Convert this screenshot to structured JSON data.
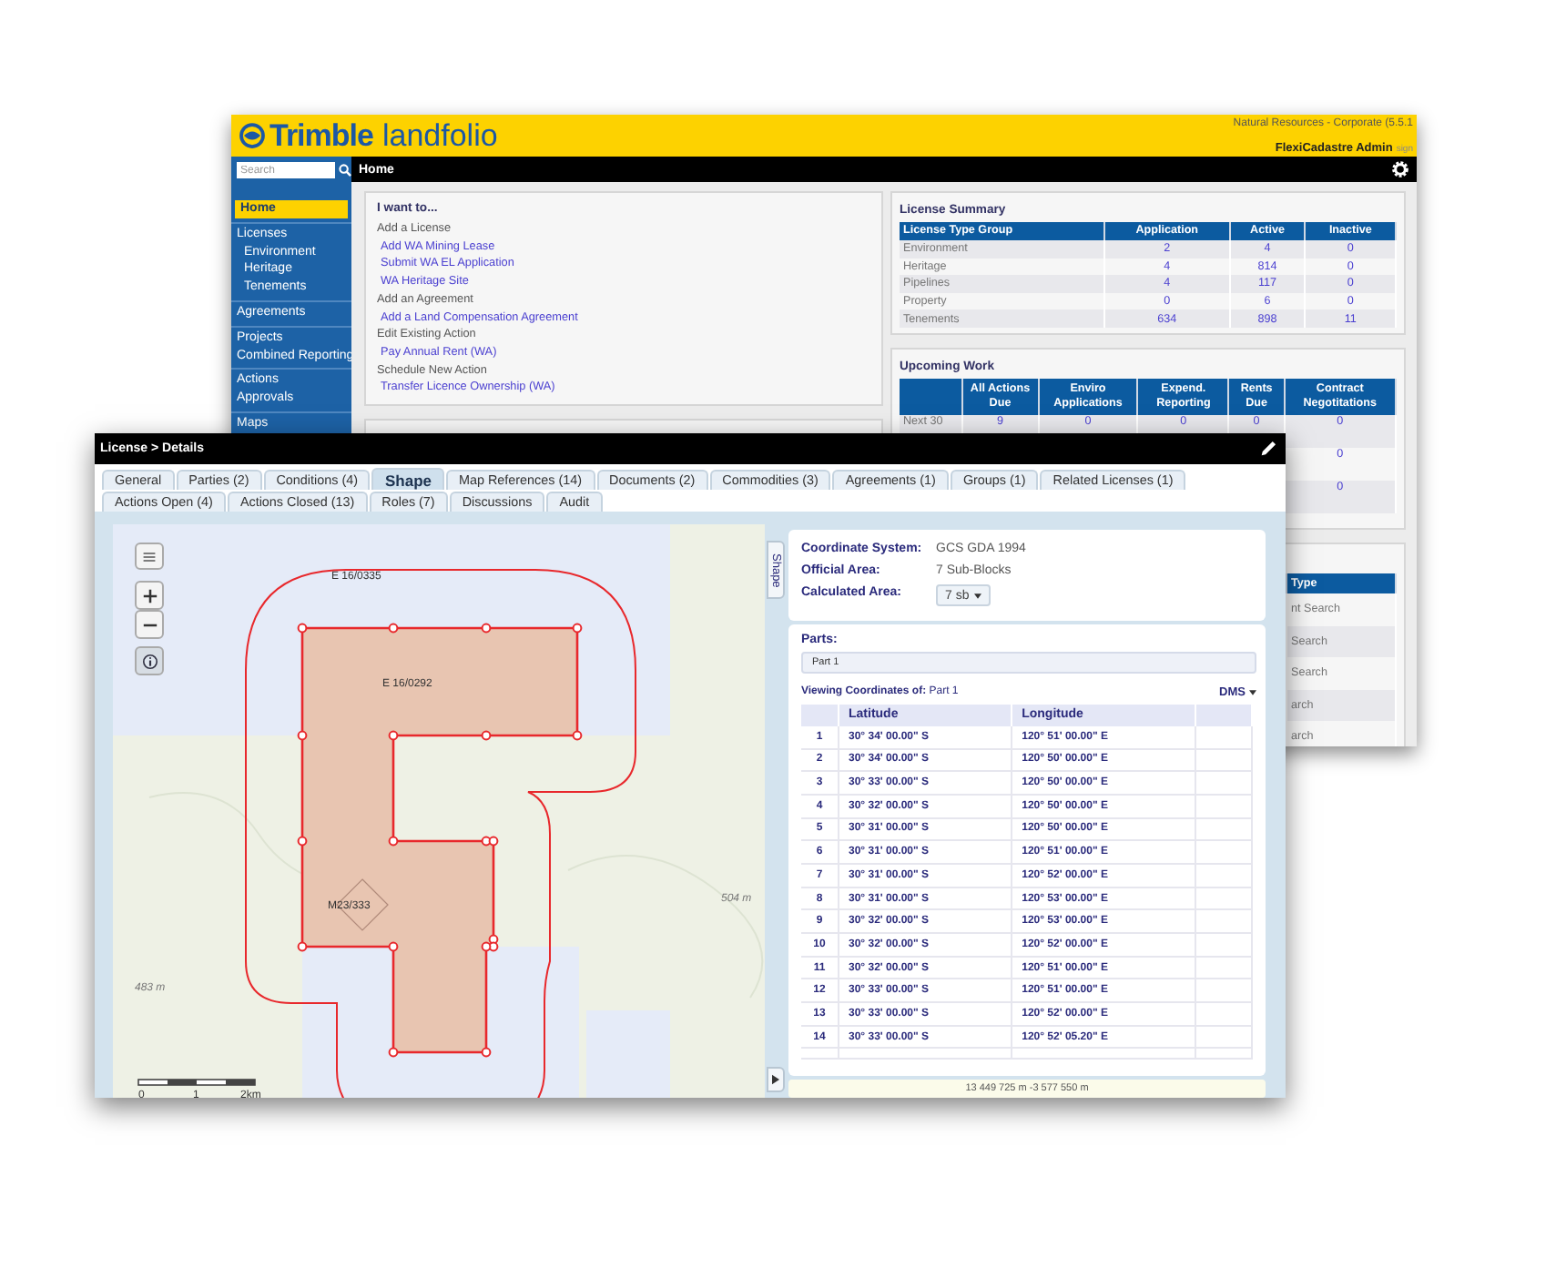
{
  "back_window": {
    "header": {
      "brand": "Trimble",
      "product": "landfolio",
      "organization": "Natural Resources - Corporate (5.5.1",
      "user": "FlexiCadastre Admin",
      "sign_link": "sign"
    },
    "search": {
      "placeholder": "Search"
    },
    "breadcrumb": "Home",
    "sidebar": {
      "groups": [
        [
          {
            "label": "Home",
            "selected": true
          }
        ],
        [
          {
            "label": "Licenses",
            "selected": false,
            "children": [
              {
                "label": "Environment",
                "selected": false
              },
              {
                "label": "Heritage",
                "selected": false
              },
              {
                "label": "Tenements",
                "selected": false
              }
            ]
          }
        ],
        [
          {
            "label": "Agreements",
            "selected": false
          }
        ],
        [
          {
            "label": "Projects",
            "selected": false
          },
          {
            "label": "Combined Reporting",
            "selected": false
          }
        ],
        [
          {
            "label": "Actions",
            "selected": false
          },
          {
            "label": "Approvals",
            "selected": false
          }
        ],
        [
          {
            "label": "Maps",
            "selected": false
          }
        ]
      ]
    },
    "i_want_to": {
      "title": "I want to...",
      "sections": [
        {
          "heading": "Add a License",
          "links": [
            "Add WA Mining Lease",
            "Submit WA EL Application",
            "WA Heritage Site"
          ]
        },
        {
          "heading": "Add an Agreement",
          "links": [
            "Add a Land Compensation Agreement"
          ]
        },
        {
          "heading": "Edit Existing Action",
          "links": [
            "Pay Annual Rent (WA)"
          ]
        },
        {
          "heading": "Schedule New Action",
          "links": [
            "Transfer Licence Ownership (WA)"
          ]
        }
      ]
    },
    "license_summary": {
      "title": "License Summary",
      "columns": [
        "License Type Group",
        "Application",
        "Active",
        "Inactive"
      ],
      "rows": [
        [
          "Environment",
          "2",
          "4",
          "0"
        ],
        [
          "Heritage",
          "4",
          "814",
          "0"
        ],
        [
          "Pipelines",
          "4",
          "117",
          "0"
        ],
        [
          "Property",
          "0",
          "6",
          "0"
        ],
        [
          "Tenements",
          "634",
          "898",
          "11"
        ]
      ]
    },
    "upcoming_work": {
      "title": "Upcoming Work",
      "columns": [
        "All Actions Due",
        "Enviro Applications",
        "Expend. Reporting",
        "Rents Due",
        "Contract Negotitations"
      ],
      "rows": [
        {
          "label": "Next 30",
          "values": [
            "9",
            "0",
            "0",
            "0",
            "0"
          ]
        },
        {
          "values": [
            "0"
          ]
        },
        {
          "values": [
            "0"
          ]
        }
      ]
    },
    "search_types": {
      "column": "Type",
      "rows": [
        "nt Search",
        "Search",
        "Search",
        "arch",
        "arch"
      ]
    }
  },
  "details_window": {
    "title": "License > Details",
    "tabs": [
      [
        {
          "label": "General",
          "selected": false
        },
        {
          "label": "Parties (2)",
          "selected": false
        },
        {
          "label": "Conditions (4)",
          "selected": false
        },
        {
          "label": "Shape",
          "selected": true
        },
        {
          "label": "Map References (14)",
          "selected": false
        },
        {
          "label": "Documents (2)",
          "selected": false
        },
        {
          "label": "Commodities (3)",
          "selected": false
        },
        {
          "label": "Agreements (1)",
          "selected": false
        },
        {
          "label": "Groups (1)",
          "selected": false
        },
        {
          "label": "Related Licenses (1)",
          "selected": false
        }
      ],
      [
        {
          "label": "Actions Open (4)",
          "selected": false
        },
        {
          "label": "Actions Closed (13)",
          "selected": false
        },
        {
          "label": "Roles (7)",
          "selected": false
        },
        {
          "label": "Discussions",
          "selected": false
        },
        {
          "label": "Audit",
          "selected": false
        }
      ]
    ],
    "map": {
      "labels": [
        "E 16/0335",
        "E 16/0292",
        "M23/333",
        "504 m",
        "483 m"
      ],
      "side_tab": "Shape",
      "scale_labels": [
        "0",
        "1",
        "2km"
      ]
    },
    "coordinates": {
      "fields": [
        {
          "label": "Coordinate System:",
          "value": "GCS GDA 1994",
          "kind": "text"
        },
        {
          "label": "Official Area:",
          "value": "7 Sub-Blocks",
          "kind": "text"
        },
        {
          "label": "Calculated Area:",
          "value": "7 sb",
          "kind": "dropdown"
        }
      ],
      "parts_title": "Parts:",
      "parts": [
        {
          "label": "Part 1",
          "selected": true
        }
      ],
      "viewing": "**Viewing Coordinates of:** Part 1",
      "format": "DMS",
      "columns": [
        "Latitude",
        "Longitude"
      ],
      "rows": [
        {
          "index": "1",
          "latitude": "30° 34' 00.00\" S",
          "longitude": "120° 51' 00.00\" E"
        },
        {
          "index": "2",
          "latitude": "30° 34' 00.00\" S",
          "longitude": "120° 50' 00.00\" E"
        },
        {
          "index": "3",
          "latitude": "30° 33' 00.00\" S",
          "longitude": "120° 50' 00.00\" E"
        },
        {
          "index": "4",
          "latitude": "30° 32' 00.00\" S",
          "longitude": "120° 50' 00.00\" E"
        },
        {
          "index": "5",
          "latitude": "30° 31' 00.00\" S",
          "longitude": "120° 50' 00.00\" E"
        },
        {
          "index": "6",
          "latitude": "30° 31' 00.00\" S",
          "longitude": "120° 51' 00.00\" E"
        },
        {
          "index": "7",
          "latitude": "30° 31' 00.00\" S",
          "longitude": "120° 52' 00.00\" E"
        },
        {
          "index": "8",
          "latitude": "30° 31' 00.00\" S",
          "longitude": "120° 53' 00.00\" E"
        },
        {
          "index": "9",
          "latitude": "30° 32' 00.00\" S",
          "longitude": "120° 53' 00.00\" E"
        },
        {
          "index": "10",
          "latitude": "30° 32' 00.00\" S",
          "longitude": "120° 52' 00.00\" E"
        },
        {
          "index": "11",
          "latitude": "30° 32' 00.00\" S",
          "longitude": "120° 51' 00.00\" E"
        },
        {
          "index": "12",
          "latitude": "30° 33' 00.00\" S",
          "longitude": "120° 51' 00.00\" E"
        },
        {
          "index": "13",
          "latitude": "30° 33' 00.00\" S",
          "longitude": "120° 52' 00.00\" E"
        },
        {
          "index": "14",
          "latitude": "30° 33' 00.00\" S",
          "longitude": "120° 52' 05.20\" E"
        }
      ],
      "readout": "13 449 725 m -3 577 550 m"
    }
  }
}
